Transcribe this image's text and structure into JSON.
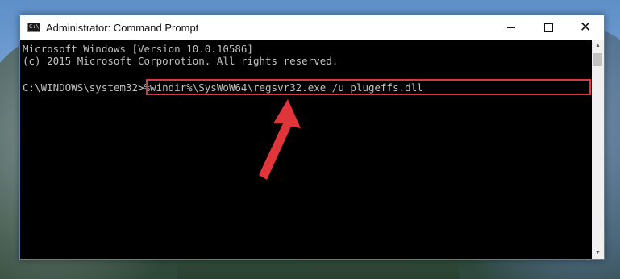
{
  "window": {
    "title": "Administrator: Command Prompt",
    "icon_text": "C:\\."
  },
  "controls": {
    "minimize_icon": "minimize-icon",
    "maximize_icon": "maximize-icon",
    "close_glyph": "✕"
  },
  "console": {
    "line1": "Microsoft Windows [Version 10.0.10586]",
    "line2": "(c) 2015 Microsoft Corporotion. All rights reserved.",
    "prompt": "C:\\WINDOWS\\system32>",
    "command": "%windir%\\SysWoW64\\regsvr32.exe /u plugeffs.dll"
  },
  "annotation": {
    "highlight_color": "#e0353a",
    "arrow_icon": "red-arrow-icon"
  },
  "scrollbar": {
    "up_glyph": "▲",
    "down_glyph": "▼"
  }
}
